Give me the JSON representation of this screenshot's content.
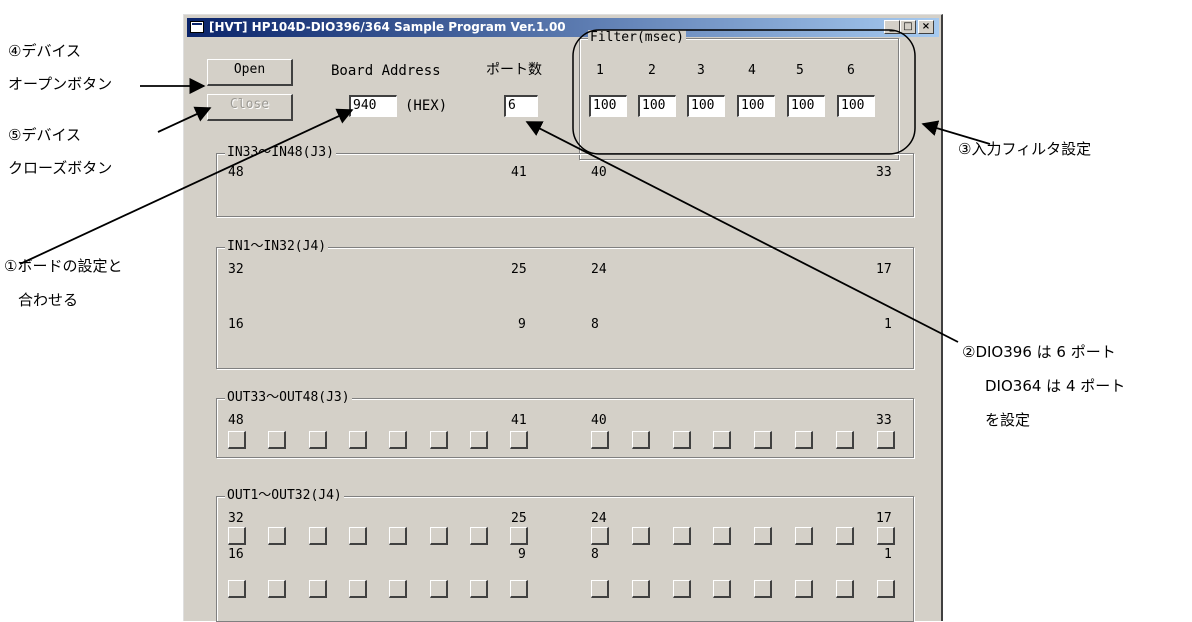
{
  "window": {
    "title": "[HVT] HP104D-DIO396/364 Sample Program Ver.1.00",
    "controls": {
      "minimize": "_",
      "maximize": "□",
      "close": "×"
    }
  },
  "buttons": {
    "open": "Open",
    "close": "Close"
  },
  "board_address": {
    "label": "Board Address",
    "value": "940",
    "unit": "(HEX)"
  },
  "ports": {
    "label": "ポート数",
    "value": "6"
  },
  "filter": {
    "label": "Filter(msec)",
    "headers": [
      "1",
      "2",
      "3",
      "4",
      "5",
      "6"
    ],
    "values": [
      "100",
      "100",
      "100",
      "100",
      "100",
      "100"
    ]
  },
  "groups": {
    "in33_48": {
      "title": "IN33〜IN48(J3)",
      "nums": [
        "48",
        "41",
        "40",
        "33"
      ]
    },
    "in1_32": {
      "title": "IN1〜IN32(J4)",
      "row1": [
        "32",
        "25",
        "24",
        "17"
      ],
      "row2": [
        "16",
        "9",
        "8",
        "1"
      ]
    },
    "out33_48": {
      "title": "OUT33〜OUT48(J3)",
      "nums": [
        "48",
        "41",
        "40",
        "33"
      ]
    },
    "out1_32": {
      "title": "OUT1〜OUT32(J4)",
      "row1": [
        "32",
        "25",
        "24",
        "17"
      ],
      "row2": [
        "16",
        "9",
        "8",
        "1"
      ]
    }
  },
  "annotations": {
    "a4_line1": "④デバイス",
    "a4_line2": "オープンボタン",
    "a5_line1": "⑤デバイス",
    "a5_line2": "クローズボタン",
    "a1_line1": "①ボードの設定と",
    "a1_line2": "合わせる",
    "a3": "③入力フィルタ設定",
    "a2_line1": "②DIO396 は 6 ポート",
    "a2_line2": "DIO364 は 4 ポート",
    "a2_line3": "を設定"
  },
  "colors": {
    "titlebar_start": "#0a246a",
    "titlebar_end": "#a6caf0",
    "face": "#d4d0c8"
  }
}
